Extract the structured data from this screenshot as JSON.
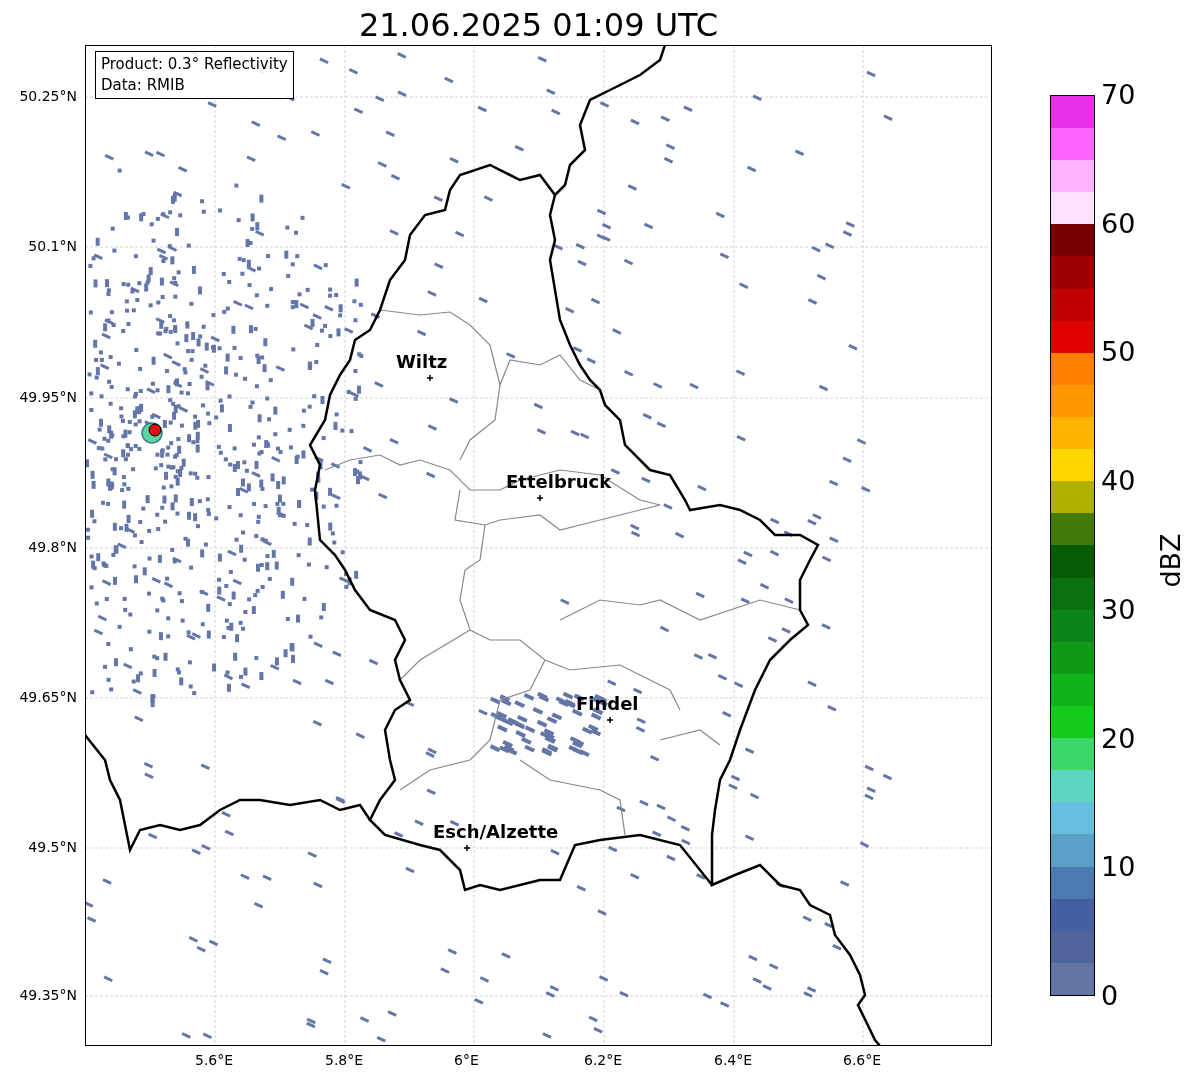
{
  "title": "21.06.2025 01:09 UTC",
  "legend": [
    "Product: 0.3° Reflectivity",
    "Data: RMIB"
  ],
  "y_ticks": [
    "50.25°N",
    "50.1°N",
    "49.95°N",
    "49.8°N",
    "49.65°N",
    "49.5°N",
    "49.35°N"
  ],
  "x_ticks": [
    "5.6°E",
    "5.8°E",
    "6°E",
    "6.2°E",
    "6.4°E",
    "6.6°E"
  ],
  "cities": [
    {
      "name": "Wiltz"
    },
    {
      "name": "Ettelbruck"
    },
    {
      "name": "Findel"
    },
    {
      "name": "Esch/Alzette"
    }
  ],
  "colorbar": {
    "label": "dBZ",
    "ticks": [
      "70",
      "60",
      "50",
      "40",
      "30",
      "20",
      "10",
      "0"
    ],
    "levels": [
      {
        "color": "#6474a4"
      },
      {
        "color": "#50669a"
      },
      {
        "color": "#4460a0"
      },
      {
        "color": "#4a7ab0"
      },
      {
        "color": "#5aa0c8"
      },
      {
        "color": "#64c0dc"
      },
      {
        "color": "#5cd6c0"
      },
      {
        "color": "#3cd66a"
      },
      {
        "color": "#14c81c"
      },
      {
        "color": "#10b418"
      },
      {
        "color": "#0e9a14"
      },
      {
        "color": "#0c8418"
      },
      {
        "color": "#0a7010"
      },
      {
        "color": "#085c08"
      },
      {
        "color": "#447a08"
      },
      {
        "color": "#b0b000"
      },
      {
        "color": "#ffd800"
      },
      {
        "color": "#ffb400"
      },
      {
        "color": "#ff9800"
      },
      {
        "color": "#ff7f00"
      },
      {
        "color": "#e00000"
      },
      {
        "color": "#c00000"
      },
      {
        "color": "#9c0000"
      },
      {
        "color": "#780000"
      },
      {
        "color": "#ffe0ff"
      },
      {
        "color": "#ffb3ff"
      },
      {
        "color": "#ff66ff"
      },
      {
        "color": "#e830e8"
      }
    ]
  }
}
